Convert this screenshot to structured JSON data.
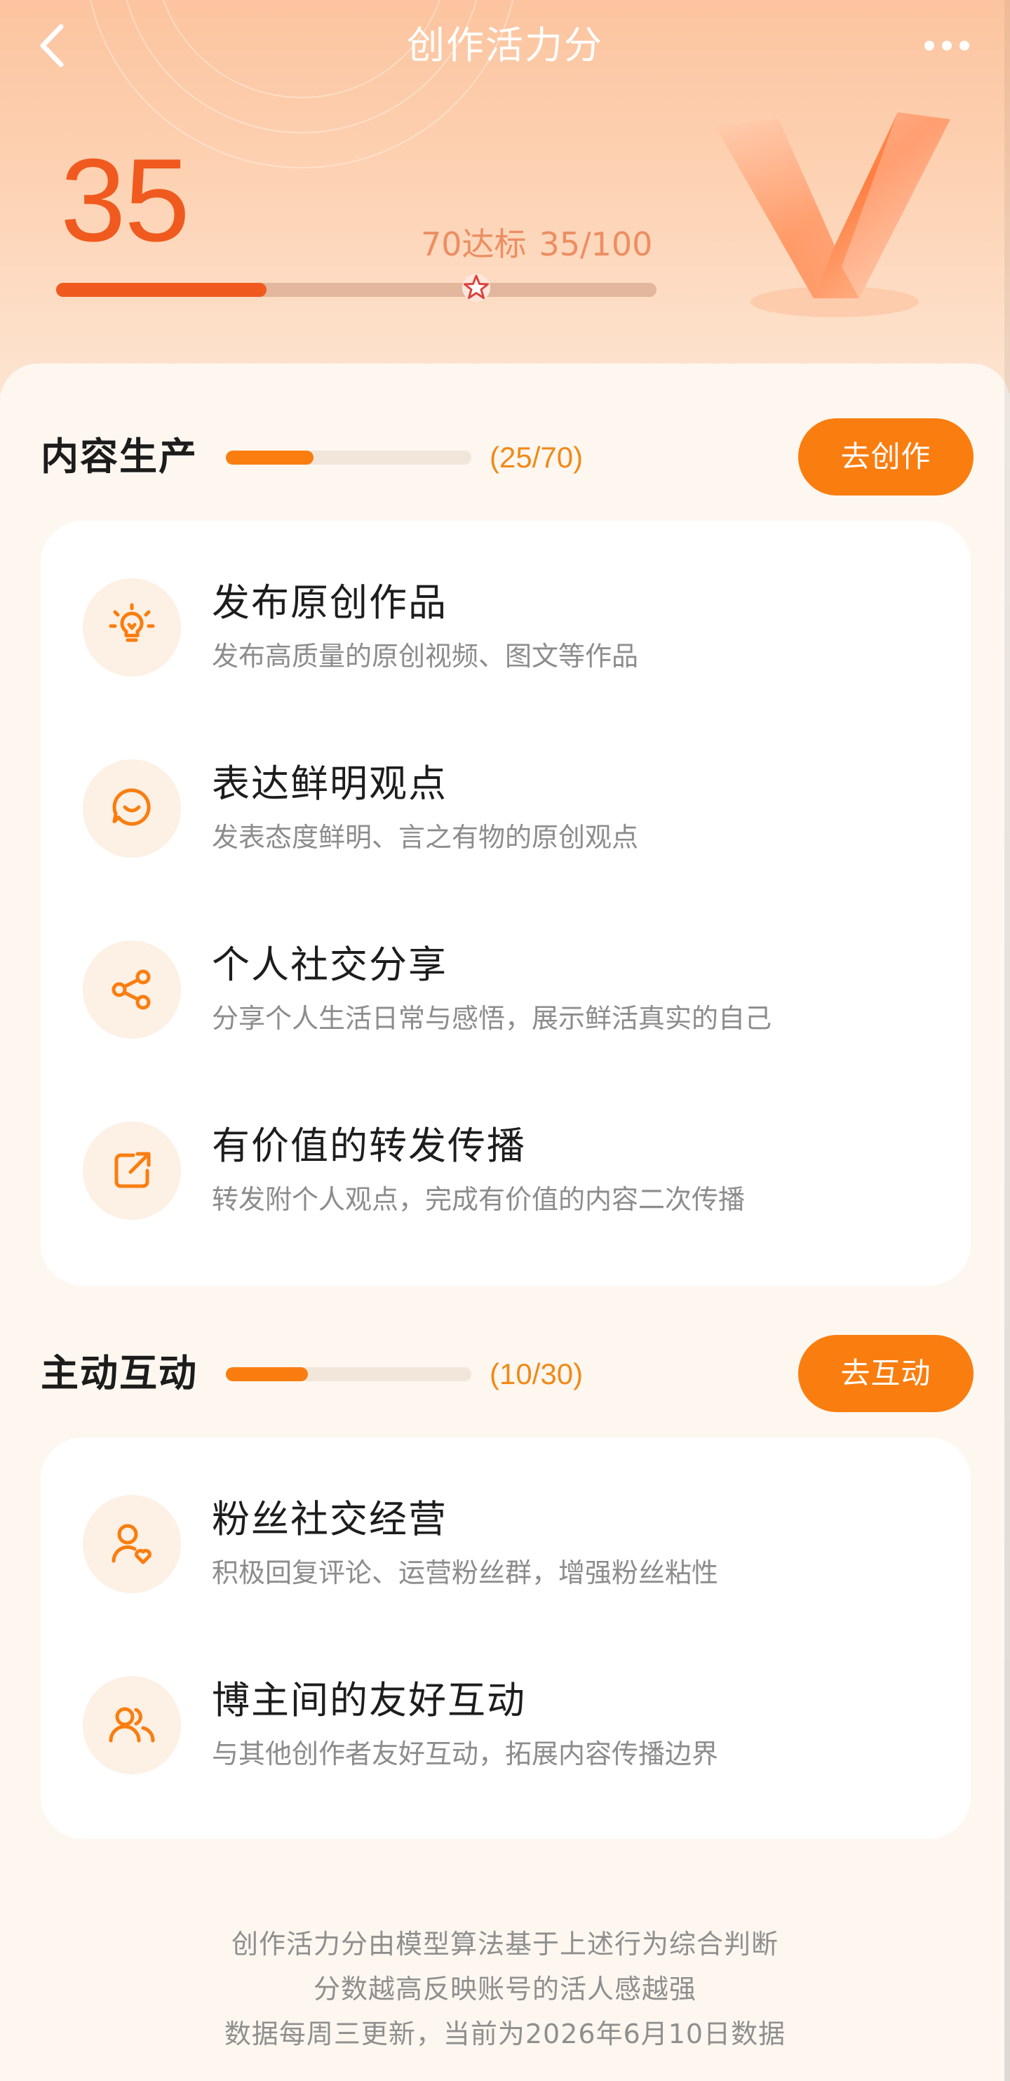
{
  "header": {
    "title": "创作活力分",
    "back_icon": "chevron-left-icon",
    "more_icon": "more-dots-icon"
  },
  "score": {
    "value": "35",
    "target_label": "70达标",
    "progress_text": "35/100",
    "progress_fraction": 0.35,
    "target_fraction": 0.7,
    "marker_icon": "star-icon"
  },
  "sections": [
    {
      "title": "内容生产",
      "count_text": "(25/70)",
      "progress_fraction": 0.357,
      "button_label": "去创作",
      "items": [
        {
          "icon": "lightbulb-icon",
          "title": "发布原创作品",
          "desc": "发布高质量的原创视频、图文等作品"
        },
        {
          "icon": "chat-bubble-icon",
          "title": "表达鲜明观点",
          "desc": "发表态度鲜明、言之有物的原创观点"
        },
        {
          "icon": "share-icon",
          "title": "个人社交分享",
          "desc": "分享个人生活日常与感悟，展示鲜活真实的自己"
        },
        {
          "icon": "forward-icon",
          "title": "有价值的转发传播",
          "desc": "转发附个人观点，完成有价值的内容二次传播"
        }
      ]
    },
    {
      "title": "主动互动",
      "count_text": "(10/30)",
      "progress_fraction": 0.333,
      "button_label": "去互动",
      "items": [
        {
          "icon": "user-heart-icon",
          "title": "粉丝社交经营",
          "desc": "积极回复评论、运营粉丝群，增强粉丝粘性"
        },
        {
          "icon": "users-icon",
          "title": "博主间的友好互动",
          "desc": "与其他创作者友好互动，拓展内容传播边界"
        }
      ]
    }
  ],
  "footer": {
    "lines": [
      "创作活力分由模型算法基于上述行为综合判断",
      "分数越高反映账号的活人感越强",
      "数据每周三更新，当前为2026年6月10日数据"
    ]
  },
  "colors": {
    "accent": "#fa7d0f",
    "score": "#f05a1e",
    "muted_text": "#8c8c8c"
  }
}
